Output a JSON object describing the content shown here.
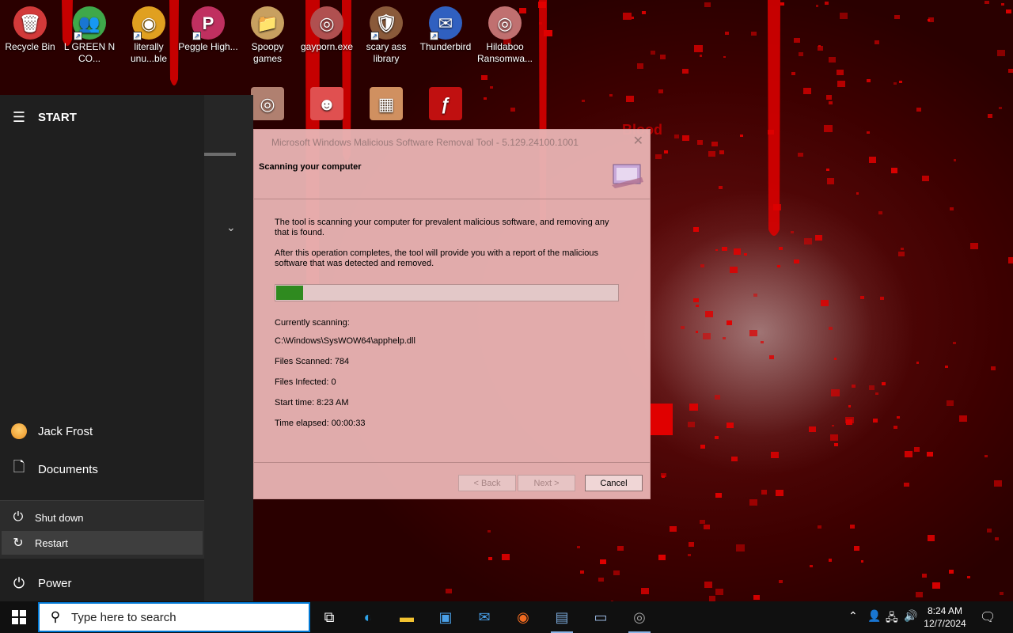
{
  "desktop": {
    "icons": [
      {
        "label": "Recycle Bin",
        "glyph": "🗑",
        "color": "#d23a3a",
        "shortcut": false
      },
      {
        "label": "L GREEN N CO...",
        "glyph": "👥",
        "color": "#3fa84a",
        "shortcut": true
      },
      {
        "label": "literally unu...ble",
        "glyph": "◉",
        "color": "#e0a020",
        "shortcut": true
      },
      {
        "label": "Peggle High...",
        "glyph": "P",
        "color": "#c03060",
        "shortcut": true
      },
      {
        "label": "Spoopy games",
        "glyph": "📁",
        "color": "#c8a060",
        "shortcut": false
      },
      {
        "label": "gayporn.exe",
        "glyph": "◎",
        "color": "#b05050",
        "shortcut": false
      },
      {
        "label": "scary ass library",
        "glyph": "🛡",
        "color": "#8a5a3a",
        "shortcut": true
      },
      {
        "label": "Thunderbird",
        "glyph": "✉",
        "color": "#3060c0",
        "shortcut": true
      },
      {
        "label": "Hildaboo Ransomwa...",
        "glyph": "◎",
        "color": "#c07070",
        "shortcut": false
      }
    ],
    "row2_icons": [
      {
        "glyph": "◎",
        "color": "#b08070"
      },
      {
        "glyph": "☻",
        "color": "#e05050"
      },
      {
        "glyph": "▦",
        "color": "#d09060"
      },
      {
        "glyph": "ƒ",
        "color": "#c01010"
      }
    ],
    "overlay_text": "Blood"
  },
  "start_menu": {
    "header": "START",
    "user_name": "Jack Frost",
    "documents_label": "Documents",
    "power_label": "Power",
    "flyout": {
      "shutdown_label": "Shut down",
      "restart_label": "Restart"
    }
  },
  "dialog": {
    "title": "Microsoft Windows Malicious Software Removal Tool - 5.129.24100.1001",
    "heading": "Scanning your computer",
    "paragraph1": "The tool is scanning your computer for prevalent malicious software, and removing any that is found.",
    "paragraph2": "After this operation completes, the tool will provide you with a report of the malicious software that was detected and removed.",
    "progress": 0.08,
    "currently_scanning_label": "Currently scanning:",
    "current_file": "C:\\Windows\\SysWOW64\\apphelp.dll",
    "files_scanned": "Files Scanned: 784",
    "files_infected": "Files Infected: 0",
    "start_time": "Start time: 8:23 AM",
    "time_elapsed": "Time elapsed: 00:00:33",
    "buttons": {
      "back": "< Back",
      "next": "Next >",
      "cancel": "Cancel"
    }
  },
  "taskbar": {
    "search_placeholder": "Type here to search",
    "apps": [
      {
        "name": "task-view-icon",
        "glyph": "⧉",
        "color": "#ffffff",
        "active": false
      },
      {
        "name": "edge-icon",
        "glyph": "◐",
        "color": "#2fa3e8",
        "active": false
      },
      {
        "name": "file-explorer-icon",
        "glyph": "▬",
        "color": "#f2c230",
        "active": false
      },
      {
        "name": "store-icon",
        "glyph": "▣",
        "color": "#4aa0e8",
        "active": false
      },
      {
        "name": "mail-icon",
        "glyph": "✉",
        "color": "#4aa0e8",
        "active": false
      },
      {
        "name": "firefox-icon",
        "glyph": "◉",
        "color": "#f06a20",
        "active": false
      },
      {
        "name": "mrt-tool-icon",
        "glyph": "▤",
        "color": "#7aa8d8",
        "active": true
      },
      {
        "name": "computer-icon",
        "glyph": "▭",
        "color": "#9ab8e0",
        "active": false
      },
      {
        "name": "globe-app-icon",
        "glyph": "◎",
        "color": "#a0a0a0",
        "active": true
      }
    ],
    "clock_time": "8:24 AM",
    "clock_date": "12/7/2024"
  },
  "colors": {
    "accent": "#0078d4",
    "progress_green": "#2f8a1f",
    "blood_red": "#e00000"
  }
}
